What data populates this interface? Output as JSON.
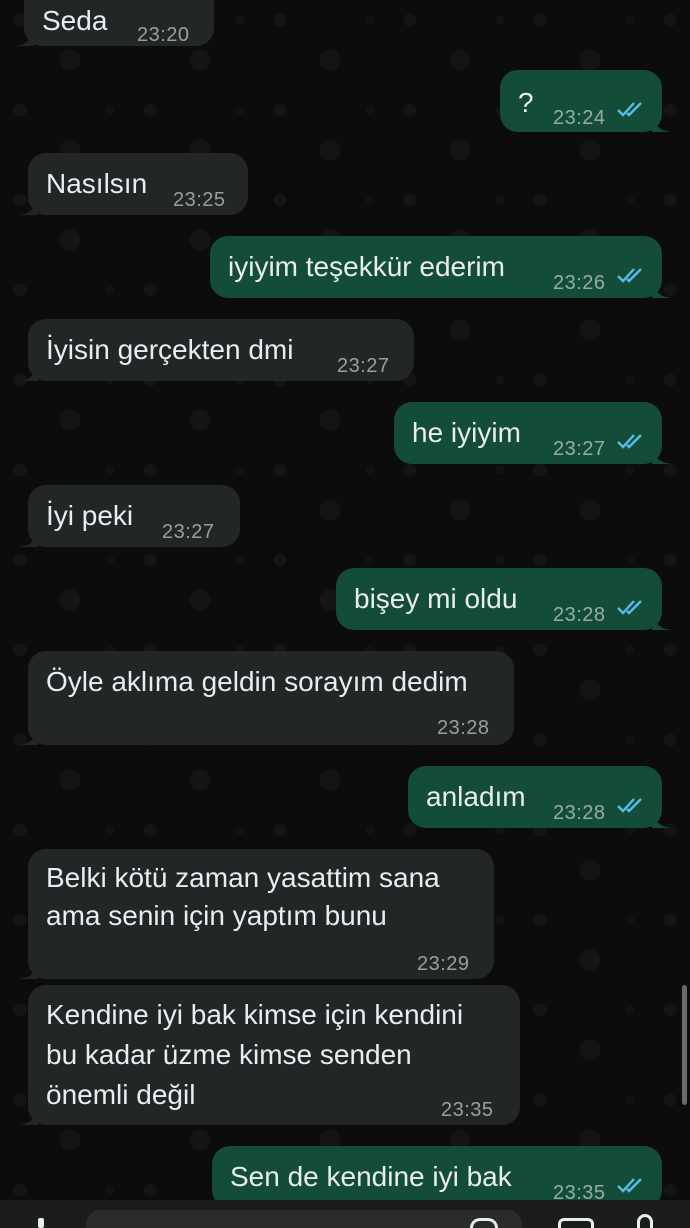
{
  "messages": [
    {
      "direction": "in",
      "text": "Seda",
      "time": "23:20"
    },
    {
      "direction": "out",
      "text": "?",
      "time": "23:24",
      "read": true
    },
    {
      "direction": "in",
      "text": "Nasılsın",
      "time": "23:25"
    },
    {
      "direction": "out",
      "text": "iyiyim teşekkür ederim",
      "time": "23:26",
      "read": true
    },
    {
      "direction": "in",
      "text": "İyisin gerçekten dmi",
      "time": "23:27"
    },
    {
      "direction": "out",
      "text": "he iyiyim",
      "time": "23:27",
      "read": true
    },
    {
      "direction": "in",
      "text": "İyi peki",
      "time": "23:27"
    },
    {
      "direction": "out",
      "text": "bişey mi oldu",
      "time": "23:28",
      "read": true
    },
    {
      "direction": "in",
      "text": "Öyle aklıma geldin sorayım dedim",
      "time": "23:28"
    },
    {
      "direction": "out",
      "text": "anladım",
      "time": "23:28",
      "read": true
    },
    {
      "direction": "in",
      "text": "Belki kötü zaman yasattim sana\nama senin için yaptım bunu",
      "time": "23:29"
    },
    {
      "direction": "in",
      "text": "Kendine iyi bak kimse için kendini\nbu kadar üzme kimse senden\nönemli değil",
      "time": "23:35"
    },
    {
      "direction": "out",
      "text": "Sen de kendine iyi bak",
      "time": "23:35",
      "read": true
    }
  ],
  "colors": {
    "incoming_bubble": "#232626",
    "outgoing_bubble": "#144d37",
    "read_ticks": "#53bdeb",
    "background": "#0c0c0c"
  },
  "icons": {
    "read_receipt": "double-check-icon",
    "attach": "plus-icon",
    "sticker": "sticker-icon",
    "camera": "camera-icon",
    "mic": "mic-icon"
  }
}
